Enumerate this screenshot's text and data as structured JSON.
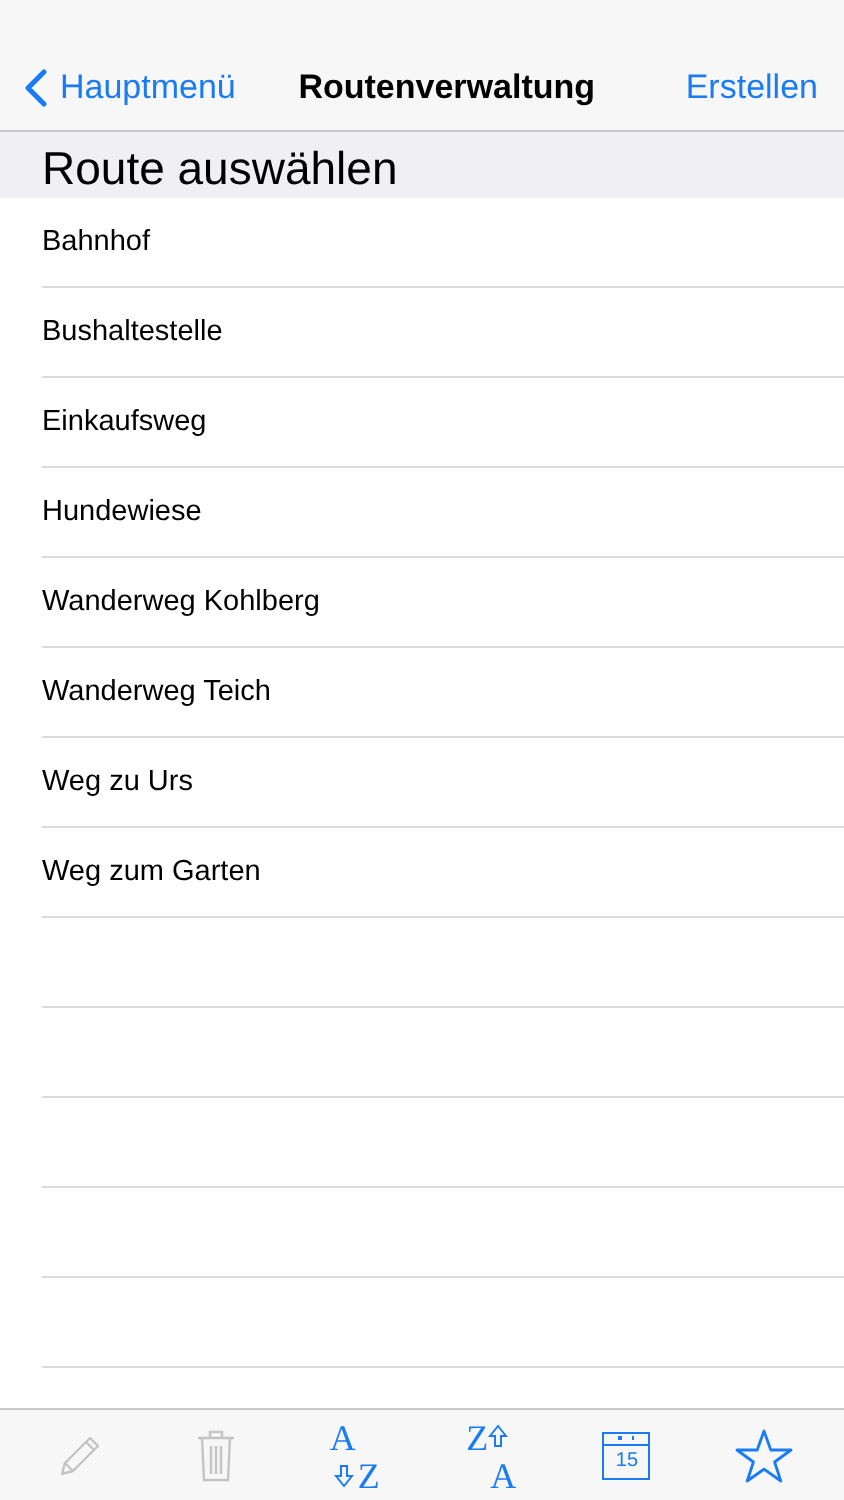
{
  "nav": {
    "back": "Hauptmenü",
    "title": "Routenverwaltung",
    "action": "Erstellen"
  },
  "section": "Route auswählen",
  "routes": [
    "Bahnhof",
    "Bushaltestelle",
    "Einkaufsweg",
    "Hundewiese",
    "Wanderweg Kohlberg",
    "Wanderweg Teich",
    "Weg zu Urs",
    "Weg zum Garten"
  ],
  "toolbar": [
    {
      "kind": "pencil",
      "disabled": true
    },
    {
      "kind": "trash",
      "disabled": true
    },
    {
      "kind": "sort",
      "disabled": false,
      "top": "A",
      "bottom": "Z"
    },
    {
      "kind": "sort-reverse",
      "disabled": false,
      "top": "Z",
      "bottom": "A"
    },
    {
      "kind": "calendar",
      "disabled": false,
      "day": "15"
    },
    {
      "kind": "star",
      "disabled": false
    }
  ]
}
